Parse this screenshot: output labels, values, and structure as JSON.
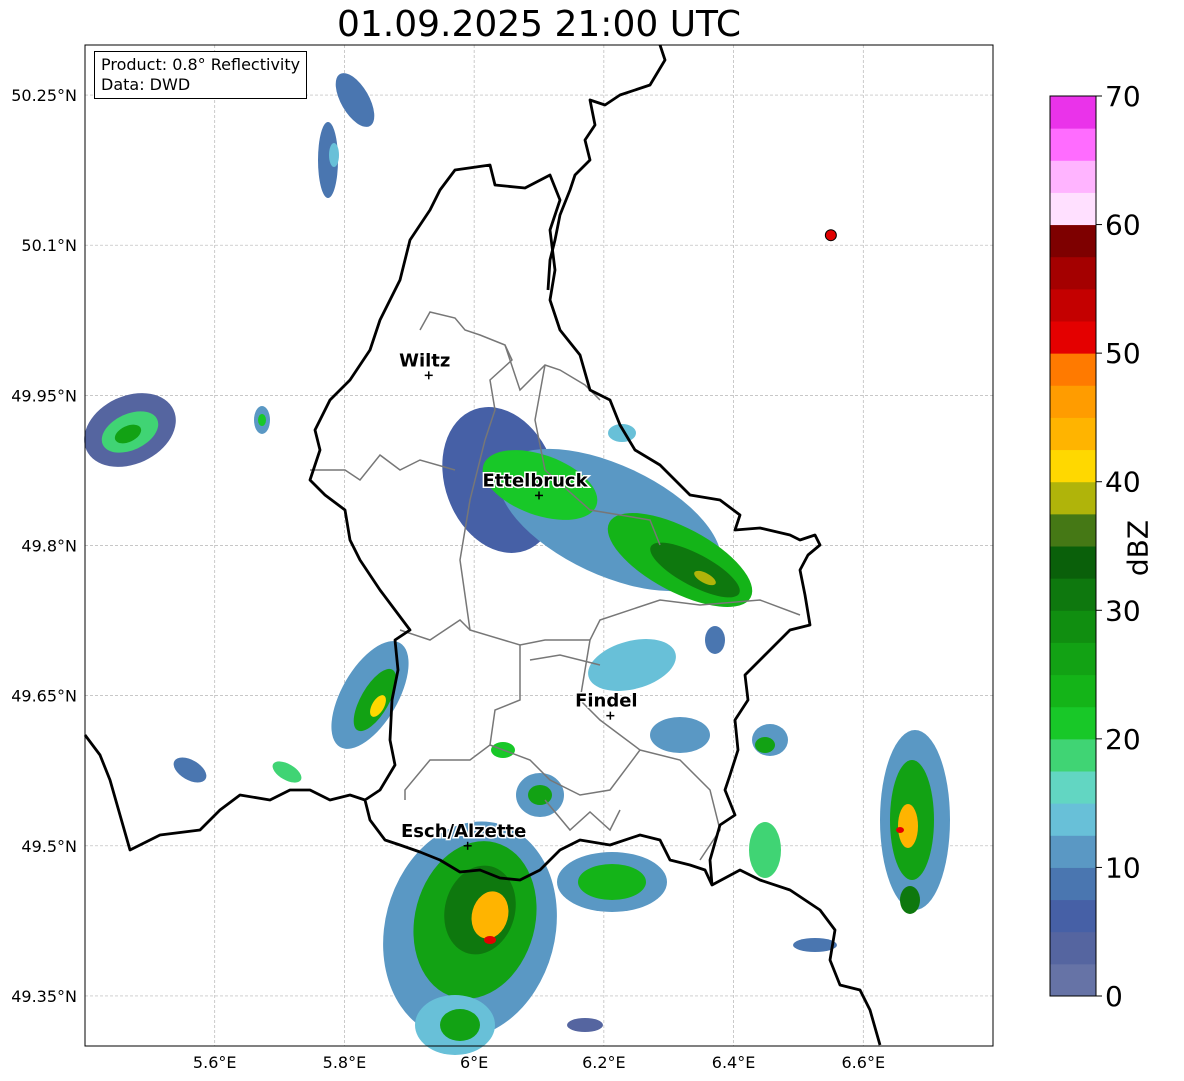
{
  "title": "01.09.2025 21:00 UTC",
  "info": {
    "product": "Product: 0.8° Reflectivity",
    "data": "Data: DWD"
  },
  "map": {
    "lon_range": [
      5.4,
      6.8
    ],
    "lat_range": [
      49.3,
      50.3
    ],
    "lon_ticks": [
      "5.6°E",
      "5.8°E",
      "6°E",
      "6.2°E",
      "6.4°E",
      "6.6°E"
    ],
    "lat_ticks": [
      "49.35°N",
      "49.5°N",
      "49.65°N",
      "49.8°N",
      "49.95°N",
      "50.1°N",
      "50.25°N"
    ],
    "cities": [
      {
        "name": "Wiltz",
        "lon": 5.93,
        "lat": 49.97
      },
      {
        "name": "Ettelbruck",
        "lon": 6.1,
        "lat": 49.85
      },
      {
        "name": "Findel",
        "lon": 6.21,
        "lat": 49.63
      },
      {
        "name": "Esch/Alzette",
        "lon": 5.99,
        "lat": 49.5
      }
    ],
    "marker": {
      "lon": 6.55,
      "lat": 50.11,
      "color": "#e00000"
    }
  },
  "colorbar": {
    "label": "dBZ",
    "min": 0,
    "max": 70,
    "ticks": [
      "0",
      "10",
      "20",
      "30",
      "40",
      "50",
      "60",
      "70"
    ],
    "colors": [
      "#6673a6",
      "#5565a0",
      "#4660a6",
      "#4a76b0",
      "#5a98c4",
      "#68c0d8",
      "#62d6c2",
      "#40d474",
      "#18c828",
      "#14b418",
      "#12a214",
      "#108e10",
      "#0e780e",
      "#0a600a",
      "#457815",
      "#b0b40a",
      "#ffd800",
      "#ffb400",
      "#ff9c00",
      "#ff7a00",
      "#e40000",
      "#c40000",
      "#a40000",
      "#7e0000",
      "#ffe0ff",
      "#ffb4ff",
      "#ff6cff",
      "#ea33ea"
    ]
  }
}
